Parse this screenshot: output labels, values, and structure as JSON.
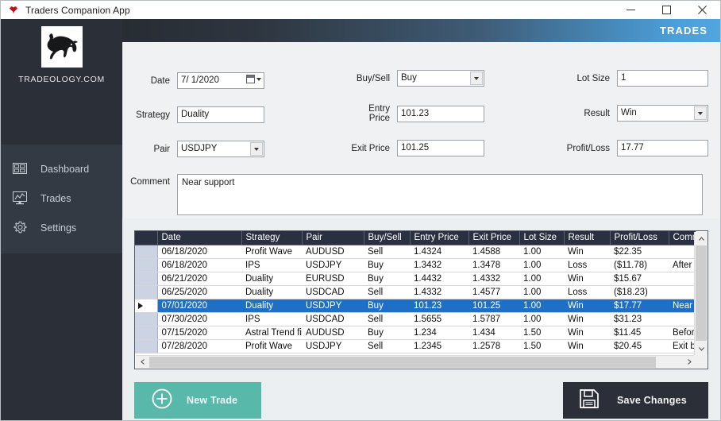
{
  "window": {
    "title": "Traders Companion App",
    "icon": "bull-head-icon",
    "minimize_label": "–",
    "maximize_label": "□",
    "close_label": "✕"
  },
  "sidebar": {
    "logo_icon": "bull-logo",
    "brand": "TRADEOLOGY.COM",
    "items": [
      {
        "label": "Dashboard",
        "icon": "dashboard-icon"
      },
      {
        "label": "Trades",
        "icon": "chart-monitor-icon"
      },
      {
        "label": "Settings",
        "icon": "gear-icon"
      }
    ]
  },
  "banner": {
    "title": "TRADES",
    "gradient_from": "#282d34",
    "gradient_to": "#51a6e0"
  },
  "form": {
    "date": {
      "label": "Date",
      "value": "7/  1/2020"
    },
    "strategy": {
      "label": "Strategy",
      "value": "Duality"
    },
    "pair": {
      "label": "Pair",
      "value": "USDJPY"
    },
    "buysell": {
      "label": "Buy/Sell",
      "value": "Buy"
    },
    "entry_price": {
      "label": "Entry Price",
      "value": "101.23"
    },
    "exit_price": {
      "label": "Exit Price",
      "value": "101.25"
    },
    "lot_size": {
      "label": "Lot Size",
      "value": "1"
    },
    "result": {
      "label": "Result",
      "value": "Win"
    },
    "profit_loss": {
      "label": "Profit/Loss",
      "value": "17.77"
    },
    "comment": {
      "label": "Comment",
      "value": "Near support"
    }
  },
  "grid": {
    "columns": [
      "Date",
      "Strategy",
      "Pair",
      "Buy/Sell",
      "Entry Price",
      "Exit Price",
      "Lot Size",
      "Result",
      "Profit/Loss",
      "Comment"
    ],
    "selected_index": 4,
    "rows": [
      {
        "date": "06/18/2020",
        "strategy": "Profit Wave",
        "pair": "AUDUSD",
        "buysell": "Sell",
        "entry": "1.4324",
        "exit": "1.4588",
        "lot": "1.00",
        "result": "Win",
        "pl": "$22.35",
        "comment": ""
      },
      {
        "date": "06/18/2020",
        "strategy": "IPS",
        "pair": "USDJPY",
        "buysell": "Buy",
        "entry": "1.3432",
        "exit": "1.3478",
        "lot": "1.00",
        "result": "Loss",
        "pl": "($11.78)",
        "comment": "After NFP"
      },
      {
        "date": "06/21/2020",
        "strategy": "Duality",
        "pair": "EURUSD",
        "buysell": "Buy",
        "entry": "1.4432",
        "exit": "1.4332",
        "lot": "1.00",
        "result": "Win",
        "pl": "$15.67",
        "comment": ""
      },
      {
        "date": "06/25/2020",
        "strategy": "Duality",
        "pair": "USDCAD",
        "buysell": "Sell",
        "entry": "1.4332",
        "exit": "1.4577",
        "lot": "1.00",
        "result": "Loss",
        "pl": "($18.23)",
        "comment": ""
      },
      {
        "date": "07/01/2020",
        "strategy": "Duality",
        "pair": "USDJPY",
        "buysell": "Buy",
        "entry": "101.23",
        "exit": "101.25",
        "lot": "1.00",
        "result": "Win",
        "pl": "$17.77",
        "comment": "Near support"
      },
      {
        "date": "07/30/2020",
        "strategy": "IPS",
        "pair": "USDCAD",
        "buysell": "Sell",
        "entry": "1.5655",
        "exit": "1.5787",
        "lot": "1.00",
        "result": "Win",
        "pl": "$31.23",
        "comment": ""
      },
      {
        "date": "07/15/2020",
        "strategy": "Astral Trend fi...",
        "pair": "AUDUSD",
        "buysell": "Buy",
        "entry": "1.234",
        "exit": "1.434",
        "lot": "1.50",
        "result": "Win",
        "pl": "$11.45",
        "comment": "Before news"
      },
      {
        "date": "07/28/2020",
        "strategy": "Profit Wave",
        "pair": "USDJPY",
        "buysell": "Sell",
        "entry": "1.2345",
        "exit": "1.2578",
        "lot": "1.50",
        "result": "Win",
        "pl": "$20.45",
        "comment": "Exit before n"
      }
    ]
  },
  "actions": {
    "new_trade": {
      "label": "New Trade",
      "icon": "plus-circle-icon",
      "color": "#58b9ab"
    },
    "save_changes": {
      "label": "Save Changes",
      "icon": "floppy-disk-icon",
      "color": "#2b3038"
    }
  }
}
